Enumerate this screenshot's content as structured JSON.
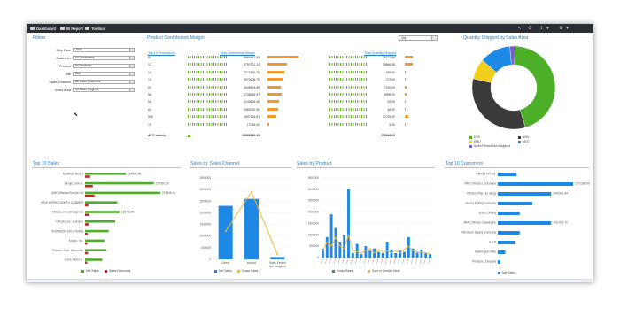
{
  "topbar": {
    "tabs": [
      {
        "label": "Dashboard",
        "icon": "dashboard-icon"
      },
      {
        "label": "BI Report",
        "icon": "chart-icon"
      },
      {
        "label": "Toolbox",
        "icon": "toolbox-icon"
      }
    ],
    "right_icons": [
      "pin-icon",
      "refresh-icon",
      "export-icon",
      "chevron-down-icon",
      "gear-icon",
      "chevron-down-icon"
    ]
  },
  "filters": {
    "title": "Filters",
    "fields": [
      {
        "label": "Ship Date",
        "value": "2008"
      },
      {
        "label": "Customer",
        "value": "All Customers"
      },
      {
        "label": "Product",
        "value": "All Products"
      },
      {
        "label": "Site",
        "value": "Dev"
      },
      {
        "label": "Sales Channel",
        "value": "All Sales Channels"
      },
      {
        "label": "Sales Area",
        "value": "All Sales Regions"
      }
    ]
  },
  "pcm": {
    "title": "Product Contribution Margin",
    "select_value": "Qty",
    "headers": {
      "product": "Top 10 Products by",
      "margin": "Total Contribution Margin",
      "qty": "Total Quantity Shipped"
    },
    "rows": [
      {
        "product": "52",
        "margin": "5969611.53",
        "qty": "35272.89"
      },
      {
        "product": "17",
        "margin": "3797021.12",
        "qty": "35866.98"
      },
      {
        "product": "14",
        "margin": "3277820.70",
        "qty": "239.00"
      },
      {
        "product": "13",
        "margin": "2979908.70",
        "qty": "272.00"
      },
      {
        "product": "21",
        "margin": "2548924.89",
        "qty": "7100.00"
      },
      {
        "product": "56",
        "margin": "2738983.97",
        "qty": "6598.00"
      },
      {
        "product": "54",
        "margin": "2140806.08",
        "qty": "92.00"
      },
      {
        "product": "61",
        "margin": "2066760.90",
        "qty": "48.00"
      },
      {
        "product": "505",
        "margin": "1697264.81",
        "qty": "17076.00"
      },
      {
        "product": "75",
        "margin": "17085.00",
        "qty": "5.00"
      }
    ],
    "total_label": "All Products",
    "total_margin": "15666150.12",
    "total_qty": "273466.00",
    "margin_fraction": [
      1.0,
      0.64,
      0.55,
      0.5,
      0.43,
      0.46,
      0.36,
      0.35,
      0.28,
      0.05
    ],
    "qty_fraction": [
      0.45,
      0.46,
      0.01,
      0.01,
      0.1,
      0.09,
      0.01,
      0.01,
      0.22,
      0.0
    ]
  },
  "qty_area": {
    "title": "Quantity Shipped by Sales Area",
    "legend": [
      {
        "label": "EUS",
        "color": "#4caf28"
      },
      {
        "label": "ASN",
        "color": "#3a3a3a"
      },
      {
        "label": "EMU",
        "color": "#f2cf1d"
      },
      {
        "label": "NEO",
        "color": "#1e88e5"
      },
      {
        "label": "Sales Person Not Assigned",
        "color": "#7b5fc8"
      }
    ]
  },
  "chart_data": [
    {
      "type": "pie",
      "title": "Quantity Shipped by Sales Area",
      "categories": [
        "EUS",
        "ASN",
        "EMU",
        "NEO",
        "Sales Person Not Assigned"
      ],
      "values": [
        45,
        33,
        8,
        12,
        2
      ],
      "colors": [
        "#4caf28",
        "#3a3a3a",
        "#f2cf1d",
        "#1e88e5",
        "#7b5fc8"
      ]
    },
    {
      "type": "bar",
      "title": "Top 10 Sales",
      "orientation": "horizontal",
      "categories": [
        "Escrikun, Bros J",
        "Bergel, Jork G.",
        "AMC Mfaukla Europe Ltd",
        "ASHI WORKS NORTH CLIMBER",
        "Olfocks, Inc. (Singapore)",
        "Olfocks, Inc. (Europe)",
        "THOMSON SOLUTIONS",
        "Koopo, Inc.",
        "Presson Noel, Gorronfile",
        "Coxx, Norin G."
      ],
      "series": [
        {
          "name": "Net Sales",
          "values": [
            95,
            160,
            175,
            75,
            80,
            70,
            55,
            45,
            50,
            40
          ]
        },
        {
          "name": "Sales Discounts",
          "values": [
            12,
            18,
            22,
            8,
            10,
            9,
            6,
            5,
            7,
            5
          ]
        }
      ],
      "data_labels": [
        "134541.88",
        "277391.59",
        "278345.10",
        "",
        "186453.71",
        "",
        "",
        "",
        "",
        ""
      ]
    },
    {
      "type": "bar",
      "title": "Sales by Sales Channel",
      "categories": [
        "Direct",
        "Indirect",
        "Sales Person Not Assigned"
      ],
      "series": [
        {
          "name": "Net Sales",
          "values": [
            2300000,
            2600000,
            100000
          ]
        },
        {
          "name": "Gross Sales",
          "values": [
            1200000,
            2900000,
            200000
          ]
        }
      ],
      "ylim": [
        0,
        3500000
      ],
      "yticks": [
        "3500000",
        "3000000",
        "2500000",
        "2000000",
        "1500000",
        "1000000",
        "500000",
        "0"
      ]
    },
    {
      "type": "bar",
      "title": "Sales by Product",
      "series": [
        {
          "name": "Gross Sales",
          "values": [
            400000,
            900000,
            1900000,
            1300000,
            700000,
            1000000,
            3000000,
            200000,
            600000,
            150000,
            500000,
            300000,
            400000,
            250000,
            200000,
            700000,
            350000,
            200000,
            300000,
            250000,
            900000,
            400000,
            250000,
            350000,
            200000,
            150000
          ]
        },
        {
          "name": "Sum of Gender Adult",
          "values": [
            300000,
            700000,
            500000,
            900000,
            500000,
            400000,
            1000000,
            300000,
            250000,
            200000,
            300000,
            400000,
            200000,
            350000,
            250000,
            300000,
            200000,
            300000,
            200000,
            350000,
            500000,
            300000,
            200000,
            250000,
            200000,
            150000
          ]
        }
      ],
      "ylim": [
        0,
        3500000
      ],
      "yticks": [
        "3500000",
        "3000000",
        "2500000",
        "2000000",
        "1500000",
        "1000000",
        "500000",
        "0"
      ]
    },
    {
      "type": "bar",
      "title": "Top 10 Customers",
      "orientation": "horizontal",
      "categories": [
        "Olfocks Int'l Ltd.",
        "MMC Olfocks Ltd Europe",
        "Olfocks (Pty) Ltd. (Aeg)",
        "Bound Drilling Company",
        "Bosco Drilling",
        "MMC Olfocks Canada Inc",
        "Petroleum Supply Company",
        "A & P",
        "Washington Mills",
        "Pinnacle Company"
      ],
      "series": [
        {
          "name": "Net Sales",
          "values": [
            30,
            120,
            85,
            55,
            35,
            85,
            35,
            28,
            12,
            4
          ]
        }
      ],
      "data_labels": [
        "",
        "1371389.96",
        "1041981.44",
        "",
        "",
        "1011421.70",
        "",
        "",
        "",
        ""
      ]
    }
  ],
  "panels": {
    "top10": {
      "title": "Top 10 Sales",
      "legend": [
        "Net Sales",
        "Sales Discounts"
      ]
    },
    "channel": {
      "title": "Sales by Sales Channel",
      "legend": [
        "Net Sales",
        "Gross Sales"
      ],
      "xlabels": [
        "Direct",
        "Indirect",
        "Sales Person Not Assigned"
      ]
    },
    "product": {
      "title": "Sales by Product",
      "legend": [
        "Gross Sales",
        "Sum of Gender Adult"
      ]
    },
    "customers": {
      "title": "Top 10 Customers",
      "legend": [
        "Net Sales"
      ]
    }
  },
  "colors": {
    "accent": "#1f7fd1",
    "green": "#4caf28",
    "red": "#c62828",
    "blue": "#1e88e5",
    "orange": "#f5b82e",
    "topbar": "#2b2f33"
  }
}
